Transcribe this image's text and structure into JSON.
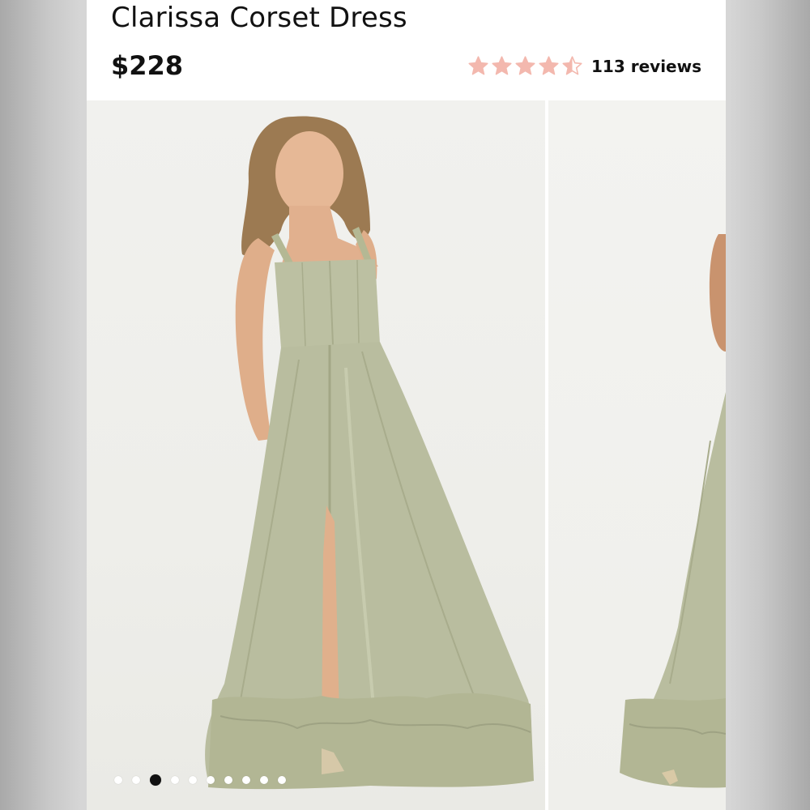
{
  "product": {
    "title": "Clarissa Corset Dress",
    "price": "$228"
  },
  "rating": {
    "value": 4.5,
    "max": 5,
    "star_color": "#f3b8ae",
    "reviews_label": "113 reviews"
  },
  "carousel": {
    "slide_count": 10,
    "active_index": 2,
    "images": [
      {
        "name": "dress-front-photo"
      },
      {
        "name": "dress-side-photo-partial"
      }
    ]
  },
  "colors": {
    "dress": "#b9bd9f",
    "background": "#ffffff",
    "text": "#111111"
  }
}
